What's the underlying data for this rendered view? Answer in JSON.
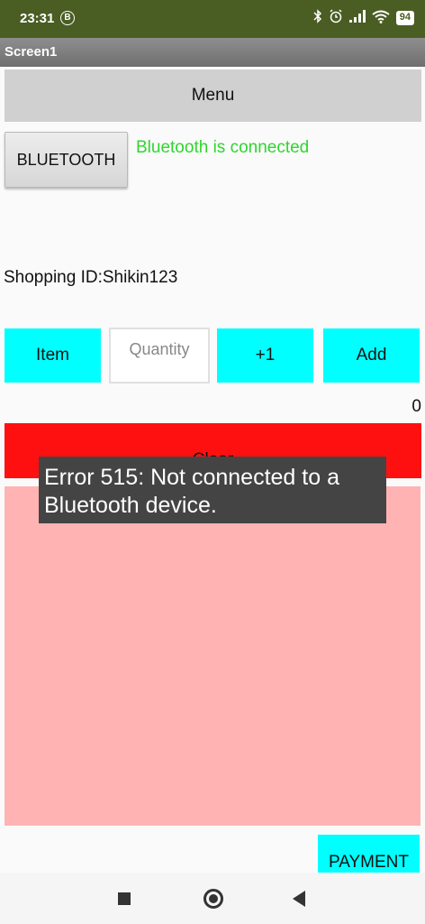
{
  "status_bar": {
    "time": "23:31",
    "badge": "B",
    "icons": [
      "bluetooth-icon",
      "alarm-icon",
      "signal-icon",
      "wifi-icon"
    ],
    "battery": "94"
  },
  "screen": {
    "title": "Screen1"
  },
  "menu": {
    "label": "Menu"
  },
  "bluetooth": {
    "button_label": "BLUETOOTH",
    "status": "Bluetooth is connected"
  },
  "shopping": {
    "id_label": "Shopping ID:Shikin123"
  },
  "controls": {
    "item_label": "Item",
    "quantity_placeholder": "Quantity",
    "plus_label": "+1",
    "add_label": "Add"
  },
  "total": "0",
  "clear": {
    "label": "Clear"
  },
  "toast": {
    "message": "Error 515: Not connected to a Bluetooth device."
  },
  "payment": {
    "label": "PAYMENT"
  },
  "colors": {
    "status_bar": "#4a5d23",
    "connected_text": "#2ed72e",
    "cyan_buttons": "#00ffff",
    "clear_button": "#ff1010",
    "list_area": "#ffb3b3",
    "toast_bg": "#444444"
  }
}
